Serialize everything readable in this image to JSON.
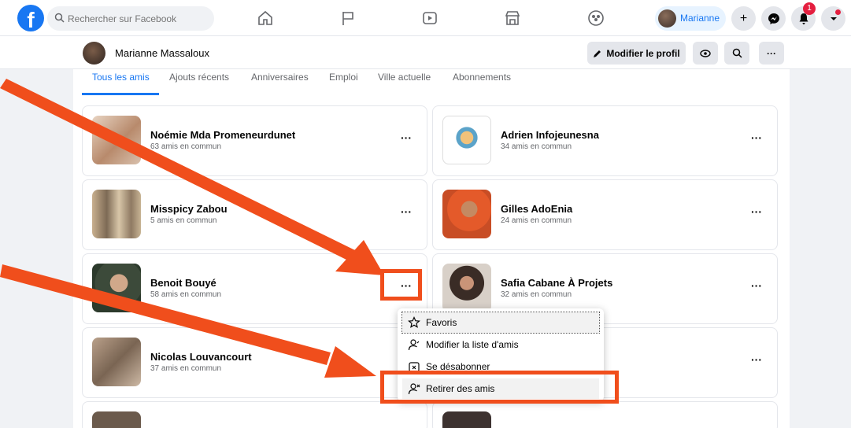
{
  "search": {
    "placeholder": "Rechercher sur Facebook"
  },
  "user": {
    "name": "Marianne"
  },
  "notifications": {
    "count": "1"
  },
  "profile": {
    "name": "Marianne Massaloux",
    "edit_label": "Modifier le profil",
    "more_label": "···"
  },
  "tabs": [
    {
      "label": "Tous les amis",
      "active": true
    },
    {
      "label": "Ajouts récents"
    },
    {
      "label": "Anniversaires"
    },
    {
      "label": "Emploi"
    },
    {
      "label": "Ville actuelle"
    },
    {
      "label": "Abonnements"
    }
  ],
  "friends": [
    {
      "name": "Noémie Mda Promeneurdunet",
      "mutual": "63 amis en commun"
    },
    {
      "name": "Adrien Infojeunesna",
      "mutual": "34 amis en commun"
    },
    {
      "name": "Misspicy Zabou",
      "mutual": "5 amis en commun"
    },
    {
      "name": "Gilles AdoEnia",
      "mutual": "24 amis en commun"
    },
    {
      "name": "Benoit Bouyé",
      "mutual": "58 amis en commun"
    },
    {
      "name": "Safia Cabane À Projets",
      "mutual": "32 amis en commun"
    },
    {
      "name": "Nicolas Louvancourt",
      "mutual": "37 amis en commun"
    }
  ],
  "more_glyph": "···",
  "menu": {
    "items": [
      {
        "label": "Favoris",
        "icon": "star-icon"
      },
      {
        "label": "Modifier la liste d'amis",
        "icon": "person-edit-icon"
      },
      {
        "label": "Se désabonner",
        "icon": "unfollow-icon"
      },
      {
        "label": "Retirer des amis",
        "icon": "person-remove-icon"
      }
    ]
  },
  "colors": {
    "brand": "#1877f2",
    "annotation": "#f04e1c",
    "badge": "#e41e3f"
  }
}
